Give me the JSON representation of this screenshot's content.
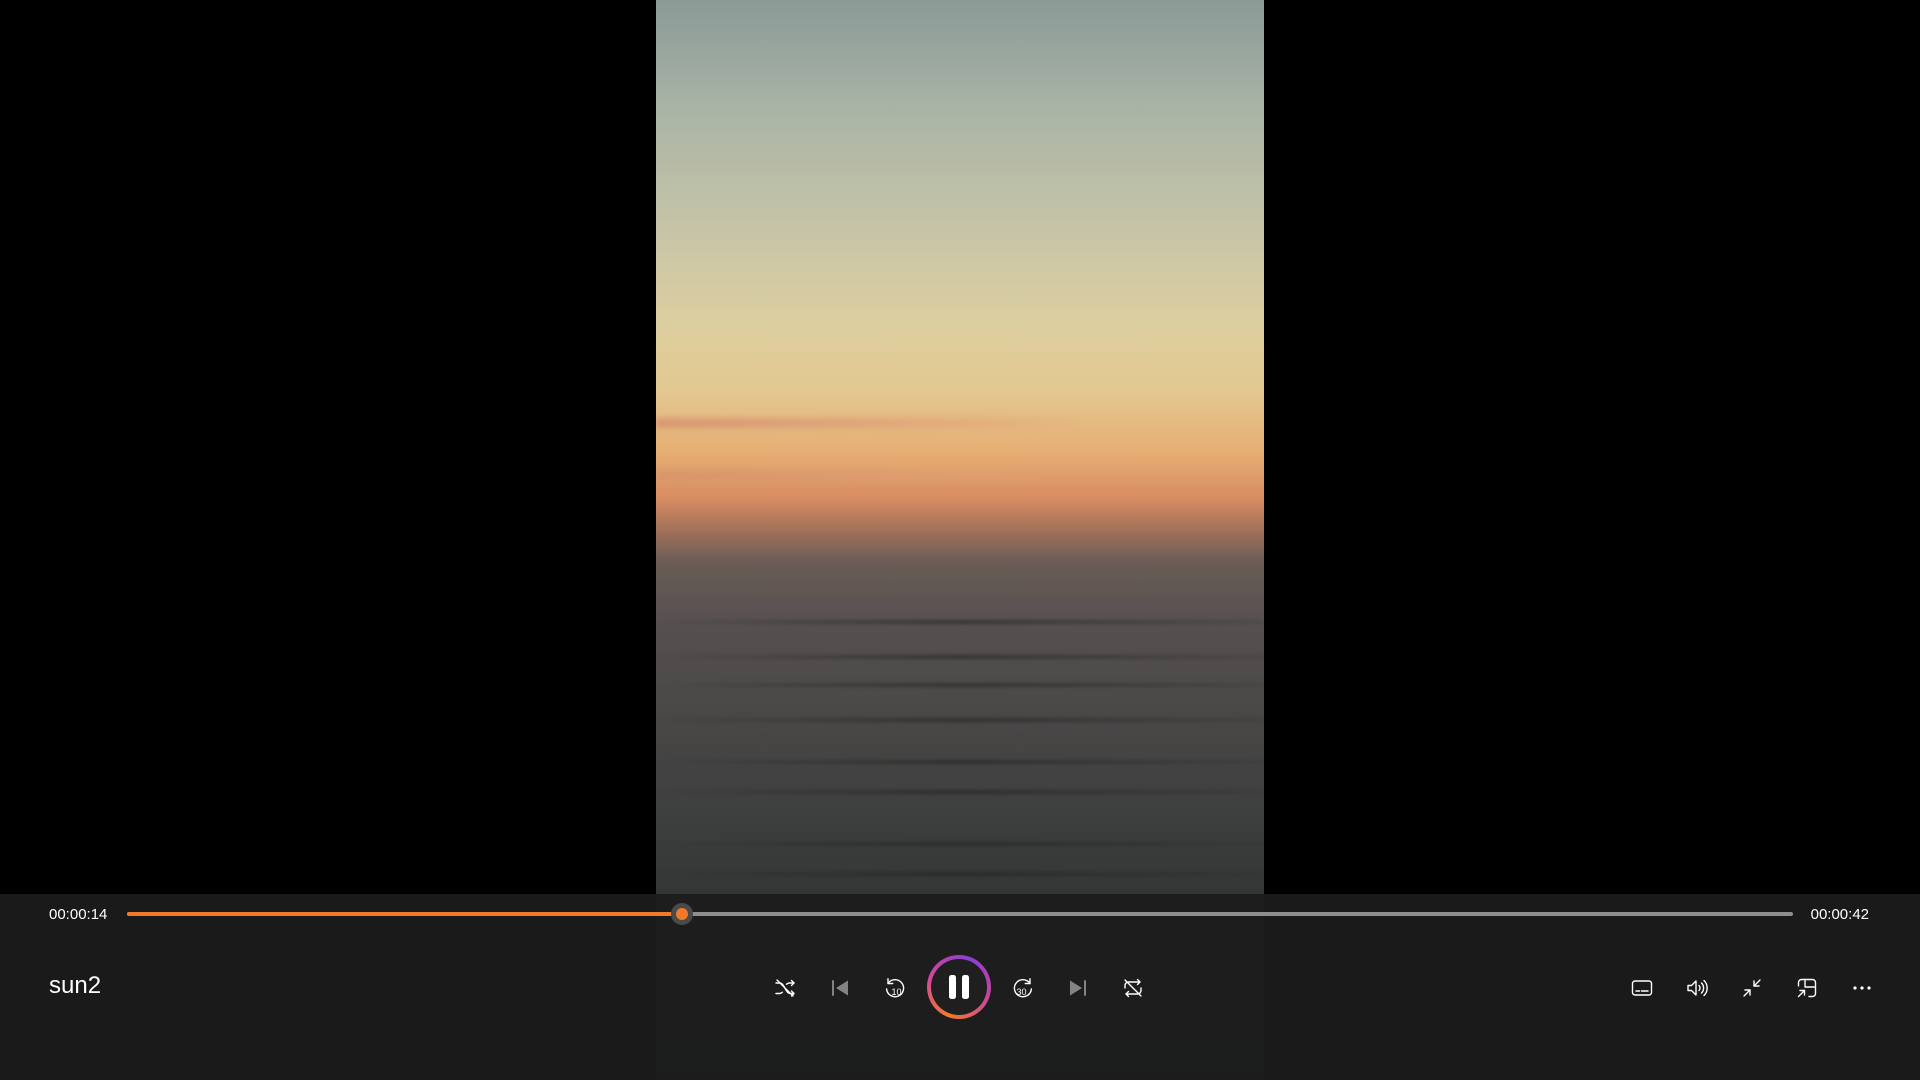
{
  "player": {
    "title": "sun2",
    "time_current": "00:00:14",
    "time_total": "00:00:42",
    "progress": 0.3333,
    "accent_color": "#f07a2a"
  },
  "icons": {
    "shuffle": "shuffle-icon",
    "previous": "previous-icon",
    "rewind": "rewind-10-icon",
    "rewind_label": "10",
    "play_pause": "pause-icon",
    "forward": "forward-30-icon",
    "forward_label": "30",
    "next": "next-icon",
    "repeat": "repeat-off-icon",
    "captions": "captions-icon",
    "volume": "volume-icon",
    "exit_fullscreen": "exit-fullscreen-icon",
    "mini_view": "mini-view-icon",
    "more": "more-icon"
  }
}
